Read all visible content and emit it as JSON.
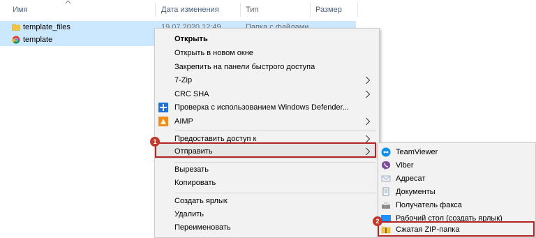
{
  "header": {
    "col_name": "Имя",
    "col_date": "Дата изменения",
    "col_type": "Тип",
    "col_size": "Размер"
  },
  "files": [
    {
      "name": "template_files",
      "date": "19.07.2020 12:49",
      "type": "Папка с файлами",
      "icon": "folder-icon"
    },
    {
      "name": "template",
      "date": "",
      "type": "",
      "icon": "chrome-icon"
    }
  ],
  "context_menu": {
    "items": [
      {
        "label": "Открыть",
        "bold": true
      },
      {
        "label": "Открыть в новом окне"
      },
      {
        "label": "Закрепить на панели быстрого доступа"
      },
      {
        "label": "7-Zip",
        "submenu": true
      },
      {
        "label": "CRC SHA",
        "submenu": true
      },
      {
        "label": "Проверка с использованием Windows Defender...",
        "icon": "defender-icon"
      },
      {
        "label": "AIMP",
        "icon": "aimp-icon",
        "submenu": true
      },
      {
        "label": "Предоставить доступ к",
        "submenu": true
      },
      {
        "label": "Отправить",
        "submenu": true,
        "highlighted": true
      },
      {
        "label": "Вырезать"
      },
      {
        "label": "Копировать"
      },
      {
        "label": "Создать ярлык"
      },
      {
        "label": "Удалить"
      },
      {
        "label": "Переименовать"
      }
    ]
  },
  "send_to_menu": {
    "items": [
      {
        "label": "TeamViewer",
        "icon": "teamviewer-icon"
      },
      {
        "label": "Viber",
        "icon": "viber-icon"
      },
      {
        "label": "Адресат",
        "icon": "contact-icon"
      },
      {
        "label": "Документы",
        "icon": "documents-icon"
      },
      {
        "label": "Получатель факса",
        "icon": "fax-icon"
      },
      {
        "label": "Рабочий стол (создать ярлык)",
        "icon": "desktop-icon"
      },
      {
        "label": "Сжатая ZIP-папка",
        "icon": "zip-folder-icon",
        "highlighted": true
      }
    ]
  },
  "badges": {
    "step1": "1",
    "step2": "2"
  },
  "colors": {
    "highlight_border": "#b32424",
    "selection": "#cce8ff",
    "badge": "#c0392b"
  }
}
